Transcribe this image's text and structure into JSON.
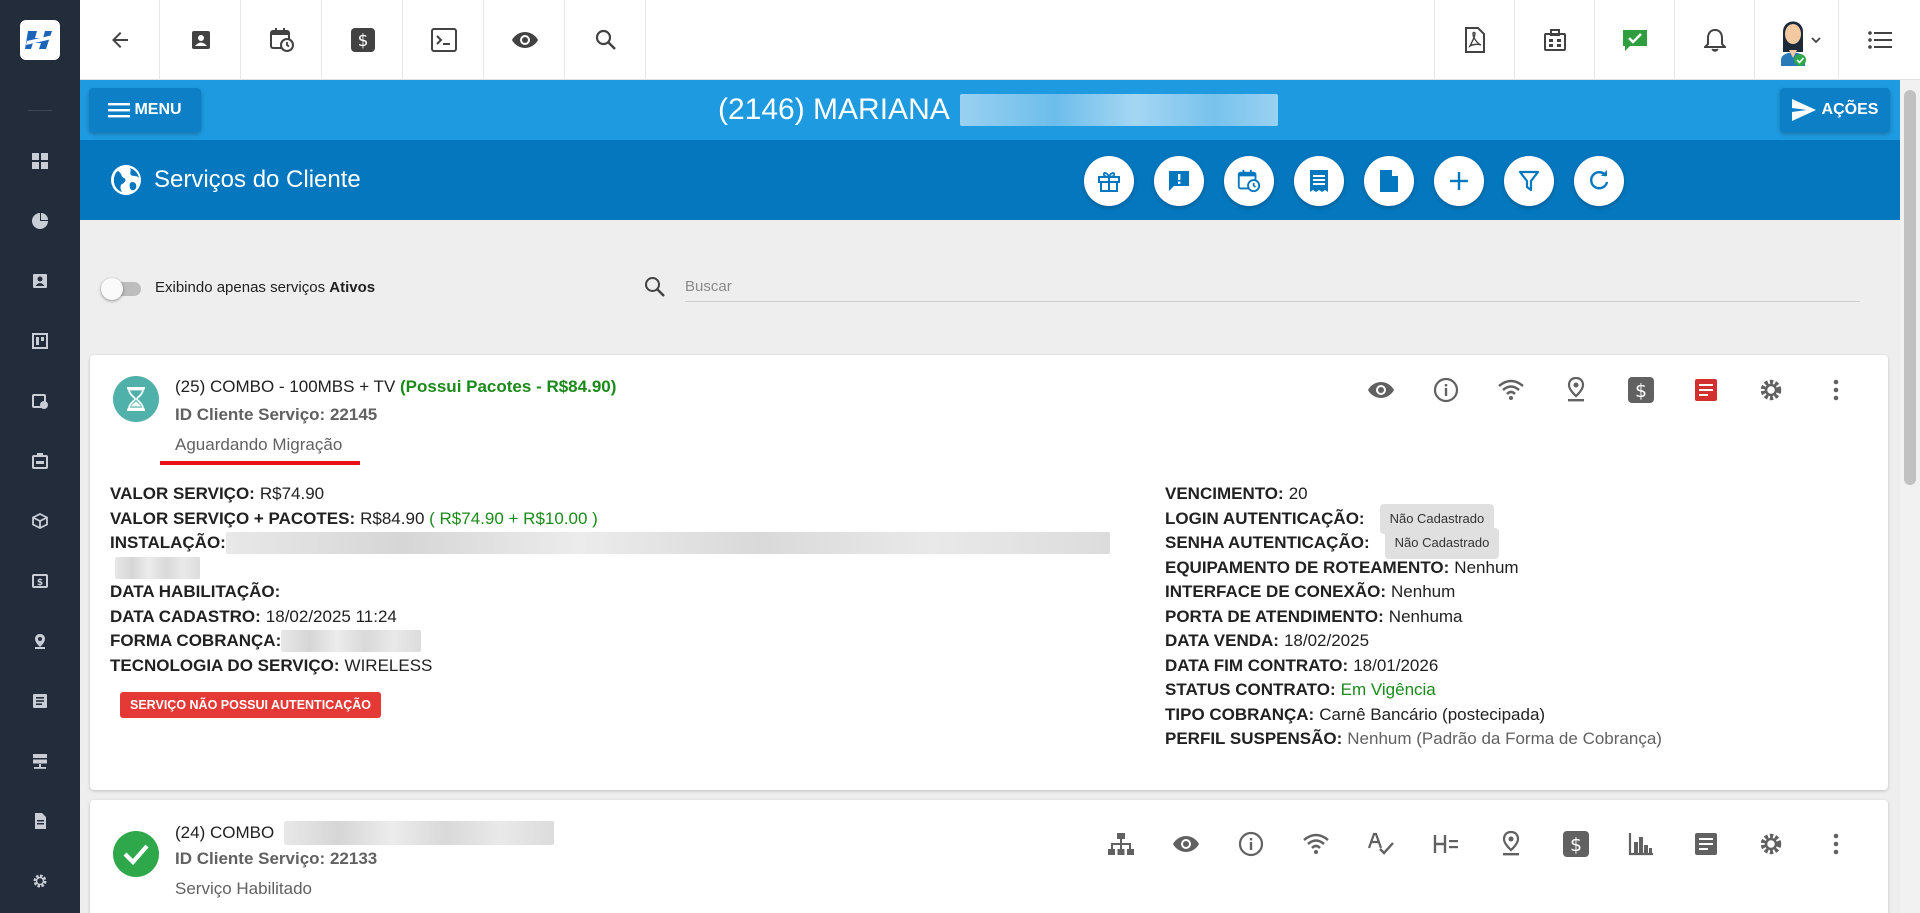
{
  "client": {
    "name": "(2146) MARIANA"
  },
  "clientbar": {
    "menu_label": "MENU",
    "actions_label": "AÇÕES"
  },
  "section": {
    "title": "Serviços do Cliente"
  },
  "filter": {
    "toggle_label_prefix": "Exibindo apenas serviços ",
    "toggle_label_bold": "Ativos",
    "search_placeholder": "Buscar"
  },
  "services": [
    {
      "title": "(25) COMBO - 100MBS + TV",
      "title_extra": "(Possui Pacotes - R$84.90)",
      "client_service_id_label": "ID Cliente Serviço:",
      "client_service_id": "22145",
      "status": "Aguardando Migração",
      "left": {
        "valor_servico": {
          "label": "VALOR SERVIÇO:",
          "value": "R$74.90"
        },
        "valor_pacotes": {
          "label": "VALOR SERVIÇO + PACOTES:",
          "value": "R$84.90",
          "detail": "( R$74.90 + R$10.00 )"
        },
        "instalacao": {
          "label": "INSTALAÇÃO:"
        },
        "data_habilitacao": {
          "label": "DATA HABILITAÇÃO:"
        },
        "data_cadastro": {
          "label": "DATA CADASTRO:",
          "value": "18/02/2025 11:24"
        },
        "forma_cobranca": {
          "label": "FORMA COBRANÇA:"
        },
        "tecnologia": {
          "label": "TECNOLOGIA DO SERVIÇO:",
          "value": "WIRELESS"
        }
      },
      "warning_badge": "SERVIÇO NÃO POSSUI AUTENTICAÇÃO",
      "right": {
        "vencimento": {
          "label": "VENCIMENTO:",
          "value": "20"
        },
        "login": {
          "label": "LOGIN AUTENTICAÇÃO:",
          "value": "Não Cadastrado"
        },
        "senha": {
          "label": "SENHA AUTENTICAÇÃO:",
          "value": "Não Cadastrado"
        },
        "equipamento": {
          "label": "EQUIPAMENTO DE ROTEAMENTO:",
          "value": "Nenhum"
        },
        "interface": {
          "label": "INTERFACE DE CONEXÃO:",
          "value": "Nenhum"
        },
        "porta": {
          "label": "PORTA DE ATENDIMENTO:",
          "value": "Nenhuma"
        },
        "data_venda": {
          "label": "DATA VENDA:",
          "value": "18/02/2025"
        },
        "data_fim": {
          "label": "DATA FIM CONTRATO:",
          "value": "18/01/2026"
        },
        "status_contrato": {
          "label": "STATUS CONTRATO:",
          "value": "Em Vigência"
        },
        "tipo_cobranca": {
          "label": "TIPO COBRANÇA:",
          "value": "Carnê Bancário (postecipada)"
        },
        "perfil_suspensao": {
          "label": "PERFIL SUSPENSÃO:",
          "value": "Nenhum (Padrão da Forma de Cobrança)"
        }
      }
    },
    {
      "title": "(24) COMBO",
      "client_service_id_label": "ID Cliente Serviço:",
      "client_service_id": "22133",
      "status": "Serviço Habilitado"
    }
  ],
  "colors": {
    "sidebar": "#232c3b",
    "client_bar": "#1e9ae0",
    "section_bar": "#0477be",
    "button_dark": "#0d7fc6",
    "badge_red": "#e53935",
    "success_green": "#1b8a1b",
    "teal_status": "#4fb1a9"
  }
}
